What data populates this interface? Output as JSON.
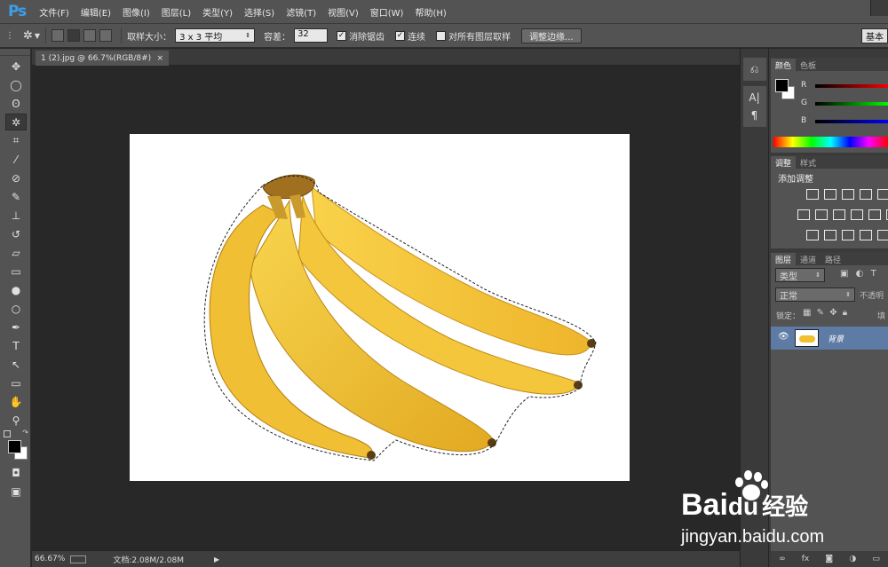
{
  "app": {
    "logo": "Ps",
    "menu": [
      "文件(F)",
      "编辑(E)",
      "图像(I)",
      "图层(L)",
      "类型(Y)",
      "选择(S)",
      "滤镜(T)",
      "视图(V)",
      "窗口(W)",
      "帮助(H)"
    ]
  },
  "options": {
    "sample_size_label": "取样大小：",
    "sample_size_value": "3 x 3 平均",
    "tolerance_label": "容差：",
    "tolerance_value": "32",
    "antialias_label": "消除锯齿",
    "contiguous_label": "连续",
    "all_layers_label": "对所有图层取样",
    "refine_edge_label": "调整边缘...",
    "workspace_label": "基本"
  },
  "document": {
    "tab_title": "1 (2).jpg @ 66.7%(RGB/8#)",
    "tab_close": "×",
    "zoom": "66.67%",
    "doc_size": "文档:2.08M/2.08M"
  },
  "panels": {
    "color_tabs": [
      "颜色",
      "色板"
    ],
    "channels": [
      "R",
      "G",
      "B"
    ],
    "adjust_tabs": [
      "调整",
      "样式"
    ],
    "adjust_title": "添加调整",
    "layers_tabs": [
      "图层",
      "通道",
      "路径"
    ],
    "filter_kind": "类型",
    "blend_mode": "正常",
    "opacity_label": "不透明",
    "lock_label": "锁定：",
    "fill_label": "填",
    "layer_name": "背景",
    "fx_label": "fx"
  },
  "watermark": {
    "brand_bai": "Bai",
    "brand_du": "du",
    "brand_jy": "经验",
    "url": "jingyan.baidu.com"
  },
  "colors": {
    "accent": "#3c9fe8",
    "panel_bg": "#535353",
    "selected_layer": "#5d7ba4",
    "banana": "#f5c53a"
  }
}
